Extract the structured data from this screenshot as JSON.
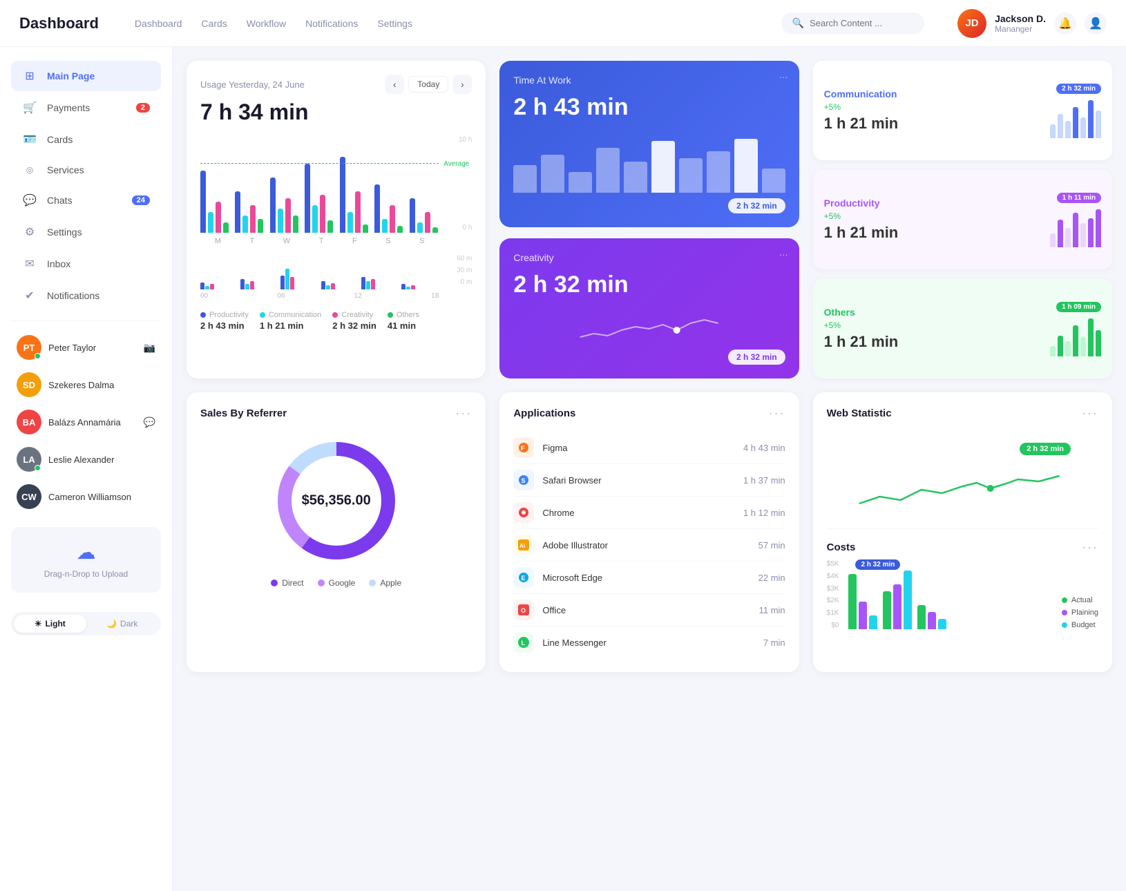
{
  "brand": "Dashboard",
  "nav": {
    "links": [
      "Dashboard",
      "Cards",
      "Workflow",
      "Notifications",
      "Settings"
    ],
    "search_placeholder": "Search Content ...",
    "user_name": "Jackson D.",
    "user_role": "Mananger",
    "user_initials": "JD"
  },
  "sidebar": {
    "items": [
      {
        "id": "main-page",
        "label": "Main Page",
        "icon": "⊞",
        "active": true
      },
      {
        "id": "payments",
        "label": "Payments",
        "icon": "🛒",
        "badge": "2"
      },
      {
        "id": "cards",
        "label": "Cards",
        "icon": "🪪"
      },
      {
        "id": "services",
        "label": "Services",
        "icon": "◎"
      },
      {
        "id": "chats",
        "label": "Chats",
        "icon": "💬",
        "badge": "24"
      },
      {
        "id": "settings",
        "label": "Settings",
        "icon": "⚙"
      },
      {
        "id": "inbox",
        "label": "Inbox",
        "icon": "✉"
      },
      {
        "id": "notifications",
        "label": "Notifications",
        "icon": "✔"
      }
    ],
    "contacts": [
      {
        "name": "Peter Taylor",
        "color": "#f97316",
        "online": true
      },
      {
        "name": "Szekeres Dalma",
        "color": "#f59e0b",
        "online": false
      },
      {
        "name": "Balázs Annamária",
        "color": "#ef4444",
        "online": false
      },
      {
        "name": "Leslie Alexander",
        "color": "#6b7280",
        "online": true
      },
      {
        "name": "Cameron Williamson",
        "color": "#374151",
        "online": false
      }
    ],
    "upload_text": "Drag-n-Drop to Upload",
    "theme": {
      "light": "Light",
      "dark": "Dark",
      "active": "light"
    }
  },
  "usage": {
    "subtitle": "Usage Yesterday, 24 June",
    "today_btn": "Today",
    "total_value": "7 h 34 min",
    "avg_label": "Average",
    "chart_labels": [
      "M",
      "T",
      "W",
      "T",
      "F",
      "S",
      "S"
    ],
    "y_labels": [
      "10 h",
      "",
      "0 h"
    ],
    "mini_labels": [
      "00",
      "06",
      "12",
      "18"
    ],
    "legend": [
      {
        "label": "Productivity",
        "value": "2 h 43 min",
        "color": "#3b5bdb"
      },
      {
        "label": "Communication",
        "value": "1 h 21 min",
        "color": "#22d3ee"
      },
      {
        "label": "Creativity",
        "value": "2 h 32 min",
        "color": "#ec4899"
      },
      {
        "label": "Others",
        "value": "41 min",
        "color": "#22c55e"
      }
    ]
  },
  "time_at_work": {
    "title": "Time At Work",
    "value": "2 h 43 min",
    "badge": "2 h 32 min"
  },
  "creativity": {
    "title": "Creativity",
    "value": "2 h 32 min",
    "badge": "2 h 32 min"
  },
  "communication": {
    "title": "Communication",
    "pct": "+5%",
    "value": "1 h 21 min",
    "badge": "2 h 32 min",
    "color": "#4f6ef7"
  },
  "productivity": {
    "title": "Productivity",
    "pct": "+5%",
    "value": "1 h 21 min",
    "badge": "1 h 11 min",
    "color": "#a855f7"
  },
  "others": {
    "title": "Others",
    "pct": "+5%",
    "value": "1 h 21 min",
    "badge": "1 h 09 min",
    "color": "#22c55e"
  },
  "sales": {
    "title": "Sales By Referrer",
    "amount": "$56,356.00",
    "legend": [
      {
        "label": "Direct",
        "color": "#7c3aed"
      },
      {
        "label": "Google",
        "color": "#c084fc"
      },
      {
        "label": "Apple",
        "color": "#bfdbfe"
      }
    ]
  },
  "applications": {
    "title": "Applications",
    "items": [
      {
        "name": "Figma",
        "time": "4 h 43 min",
        "color": "#f97316",
        "icon": "F"
      },
      {
        "name": "Safari Browser",
        "time": "1 h 37 min",
        "color": "#3b82f6",
        "icon": "S"
      },
      {
        "name": "Chrome",
        "time": "1 h 12 min",
        "color": "#ef4444",
        "icon": "C"
      },
      {
        "name": "Adobe Illustrator",
        "time": "57 min",
        "color": "#f59e0b",
        "icon": "Ai"
      },
      {
        "name": "Microsoft Edge",
        "time": "22 min",
        "color": "#0ea5e9",
        "icon": "E"
      },
      {
        "name": "Office",
        "time": "11 min",
        "color": "#ef4444",
        "icon": "O"
      },
      {
        "name": "Line Messenger",
        "time": "7 min",
        "color": "#22c55e",
        "icon": "L"
      }
    ]
  },
  "web_statistic": {
    "title": "Web Statistic",
    "badge": "2 h 32 min"
  },
  "costs": {
    "title": "Costs",
    "badge": "2 h 32 min",
    "y_labels": [
      "$5K",
      "$4K",
      "$3K",
      "$2K",
      "$1K",
      "$0"
    ],
    "legend": [
      {
        "label": "Actual",
        "color": "#22c55e"
      },
      {
        "label": "Plaining",
        "color": "#a855f7"
      },
      {
        "label": "Budget",
        "color": "#22d3ee"
      }
    ]
  }
}
